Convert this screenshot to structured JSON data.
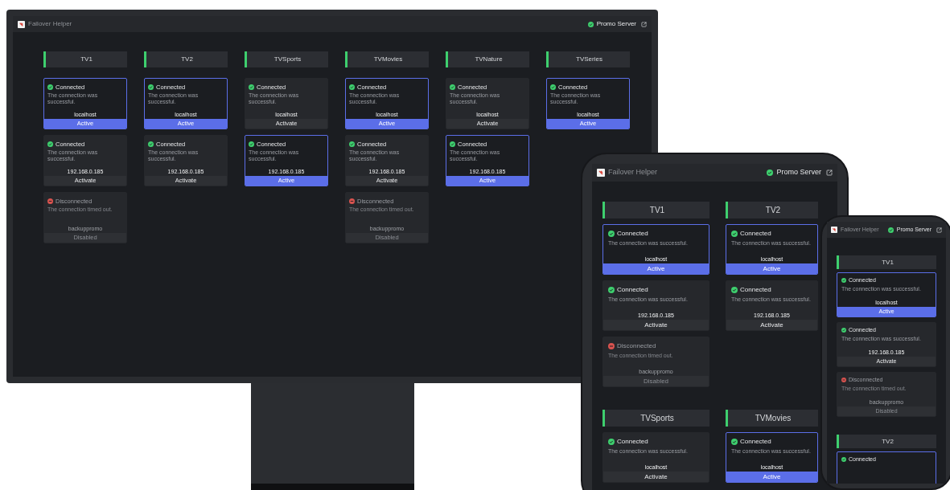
{
  "devices": [
    {
      "kind": "monitor",
      "title": "Failover Helper",
      "server": {
        "name": "Promo Server",
        "online": true
      },
      "channels": [
        {
          "name": "TV1",
          "servers": [
            {
              "connected": true,
              "status_label": "Connected",
              "message": "The connection was successful.",
              "host": "localhost",
              "action": "Active",
              "selected": true
            },
            {
              "connected": true,
              "status_label": "Connected",
              "message": "The connection was successful.",
              "host": "192.168.0.185",
              "action": "Activate",
              "selected": false
            },
            {
              "connected": false,
              "status_label": "Disconnected",
              "message": "The connection timed out.",
              "host": "backuppromo",
              "action": "Disabled",
              "selected": false
            }
          ]
        },
        {
          "name": "TV2",
          "servers": [
            {
              "connected": true,
              "status_label": "Connected",
              "message": "The connection was successful.",
              "host": "localhost",
              "action": "Active",
              "selected": true
            },
            {
              "connected": true,
              "status_label": "Connected",
              "message": "The connection was successful.",
              "host": "192.168.0.185",
              "action": "Activate",
              "selected": false
            }
          ]
        },
        {
          "name": "TVSports",
          "servers": [
            {
              "connected": true,
              "status_label": "Connected",
              "message": "The connection was successful.",
              "host": "localhost",
              "action": "Activate",
              "selected": false
            },
            {
              "connected": true,
              "status_label": "Connected",
              "message": "The connection was successful.",
              "host": "192.168.0.185",
              "action": "Active",
              "selected": true
            }
          ]
        },
        {
          "name": "TVMovies",
          "servers": [
            {
              "connected": true,
              "status_label": "Connected",
              "message": "The connection was successful.",
              "host": "localhost",
              "action": "Active",
              "selected": true
            },
            {
              "connected": true,
              "status_label": "Connected",
              "message": "The connection was successful.",
              "host": "192.168.0.185",
              "action": "Activate",
              "selected": false
            },
            {
              "connected": false,
              "status_label": "Disconnected",
              "message": "The connection timed out.",
              "host": "backuppromo",
              "action": "Disabled",
              "selected": false
            }
          ]
        },
        {
          "name": "TVNature",
          "servers": [
            {
              "connected": true,
              "status_label": "Connected",
              "message": "The connection was successful.",
              "host": "localhost",
              "action": "Activate",
              "selected": false
            },
            {
              "connected": true,
              "status_label": "Connected",
              "message": "The connection was successful.",
              "host": "192.168.0.185",
              "action": "Active",
              "selected": true
            }
          ]
        },
        {
          "name": "TVSeries",
          "servers": [
            {
              "connected": true,
              "status_label": "Connected",
              "message": "The connection was successful.",
              "host": "localhost",
              "action": "Active",
              "selected": true
            }
          ]
        }
      ]
    },
    {
      "kind": "tablet",
      "title": "Failover Helper",
      "server": {
        "name": "Promo Server",
        "online": true
      },
      "channels": [
        {
          "name": "TV1",
          "servers": [
            {
              "connected": true,
              "status_label": "Connected",
              "message": "The connection was successful.",
              "host": "localhost",
              "action": "Active",
              "selected": true
            },
            {
              "connected": true,
              "status_label": "Connected",
              "message": "The connection was successful.",
              "host": "192.168.0.185",
              "action": "Activate",
              "selected": false
            },
            {
              "connected": false,
              "status_label": "Disconnected",
              "message": "The connection timed out.",
              "host": "backuppromo",
              "action": "Disabled",
              "selected": false
            }
          ]
        },
        {
          "name": "TV2",
          "servers": [
            {
              "connected": true,
              "status_label": "Connected",
              "message": "The connection was successful.",
              "host": "localhost",
              "action": "Active",
              "selected": true
            },
            {
              "connected": true,
              "status_label": "Connected",
              "message": "The connection was successful.",
              "host": "192.168.0.185",
              "action": "Activate",
              "selected": false
            }
          ]
        },
        {
          "name": "TVSports",
          "servers": [
            {
              "connected": true,
              "status_label": "Connected",
              "message": "The connection was successful.",
              "host": "localhost",
              "action": "Activate",
              "selected": false
            }
          ]
        },
        {
          "name": "TVMovies",
          "servers": [
            {
              "connected": true,
              "status_label": "Connected",
              "message": "The connection was successful.",
              "host": "localhost",
              "action": "Active",
              "selected": true
            }
          ]
        }
      ]
    },
    {
      "kind": "phone",
      "title": "Failover Helper",
      "server": {
        "name": "Promo Server",
        "online": true
      },
      "channels": [
        {
          "name": "TV1",
          "servers": [
            {
              "connected": true,
              "status_label": "Connected",
              "message": "The connection was successful.",
              "host": "localhost",
              "action": "Active",
              "selected": true
            },
            {
              "connected": true,
              "status_label": "Connected",
              "message": "The connection was successful.",
              "host": "192.168.0.185",
              "action": "Activate",
              "selected": false
            },
            {
              "connected": false,
              "status_label": "Disconnected",
              "message": "The connection timed out.",
              "host": "backuppromo",
              "action": "Disabled",
              "selected": false
            }
          ]
        },
        {
          "name": "TV2",
          "servers": [
            {
              "connected": true,
              "status_label": "Connected",
              "selected": true
            }
          ]
        }
      ]
    }
  ]
}
